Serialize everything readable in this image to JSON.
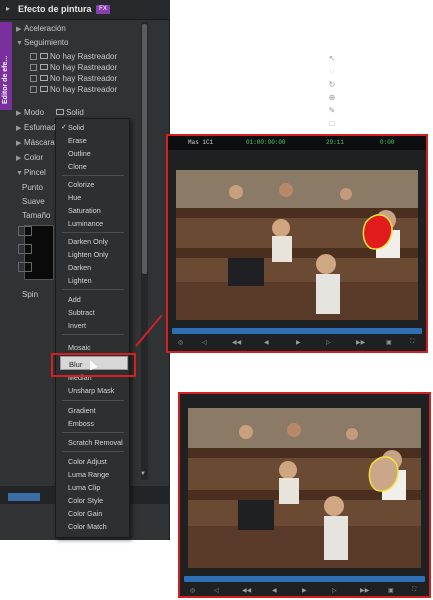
{
  "panel": {
    "title": "Efecto de pintura",
    "tag": "FX",
    "side_tab_label": "Editor de efe...",
    "rows": {
      "aceleracion": "Aceleración",
      "seguimiento": "Seguimiento",
      "trackers": [
        "No hay Rastreador",
        "No hay Rastreador",
        "No hay Rastreador",
        "No hay Rastreador"
      ],
      "modo": "Modo",
      "modo_value": "Solid",
      "esfumado": "Esfumad",
      "mascara": "Máscara",
      "color": "Color",
      "pincel": "Pincel",
      "punto": "Punto",
      "suave": "Suave",
      "tamano": "Tamaño",
      "spin": "Spin"
    }
  },
  "menu": {
    "items": [
      "Solid",
      "Erase",
      "Outline",
      "Clone",
      "Colorize",
      "Hue",
      "Saturation",
      "Luminance",
      "Darken Only",
      "Lighten Only",
      "Darken",
      "Lighten",
      "Add",
      "Subtract",
      "Invert",
      "Mosaic",
      "Blur",
      "Median",
      "Unsharp Mask",
      "Gradient",
      "Emboss",
      "Scratch Removal",
      "Color Adjust",
      "Luma Range",
      "Luma Clip",
      "Color Style",
      "Color Gain",
      "Color Match"
    ],
    "selected": "Blur",
    "checked": "Solid"
  },
  "frame1": {
    "clip": "Mas 1C1",
    "tc1": "01:00:00:00",
    "tc2": "29:11",
    "tc3": "0:00"
  },
  "colors": {
    "accent": "#d42020",
    "timeline": "#2f6fb5",
    "panel_bg": "#303234",
    "tag": "#8a3fb0"
  }
}
